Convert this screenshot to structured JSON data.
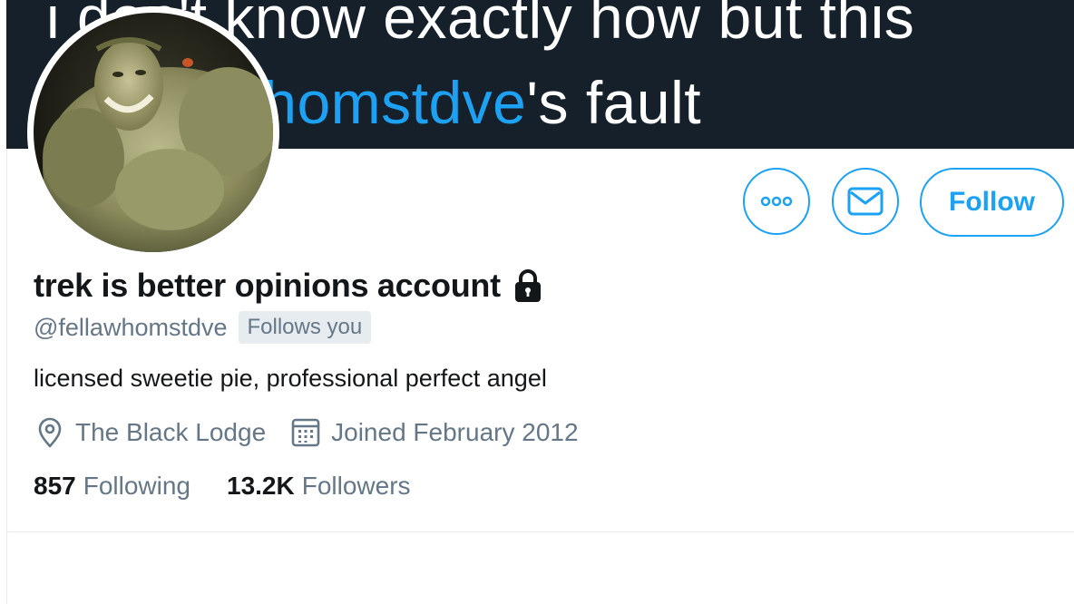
{
  "banner": {
    "line1": "i don't know exactly how but this",
    "line2_mention": "@fellawhomstdve",
    "line2_rest": "'s fault",
    "background": "#15202b",
    "mention_color": "#1da1f2"
  },
  "actions": {
    "more_icon": "more-dots-icon",
    "message_icon": "envelope-icon",
    "follow_label": "Follow",
    "accent": "#1da1f2"
  },
  "profile": {
    "display_name": "trek is better opinions account",
    "protected_icon": "lock-icon",
    "handle": "@fellawhomstdve",
    "follows_you": "Follows you",
    "bio": "licensed sweetie pie, professional perfect angel",
    "location": "The Black Lodge",
    "location_icon": "location-pin-icon",
    "joined": "Joined February 2012",
    "joined_icon": "calendar-icon"
  },
  "stats": {
    "following_count": "857",
    "following_label": "Following",
    "followers_count": "13.2K",
    "followers_label": "Followers"
  }
}
